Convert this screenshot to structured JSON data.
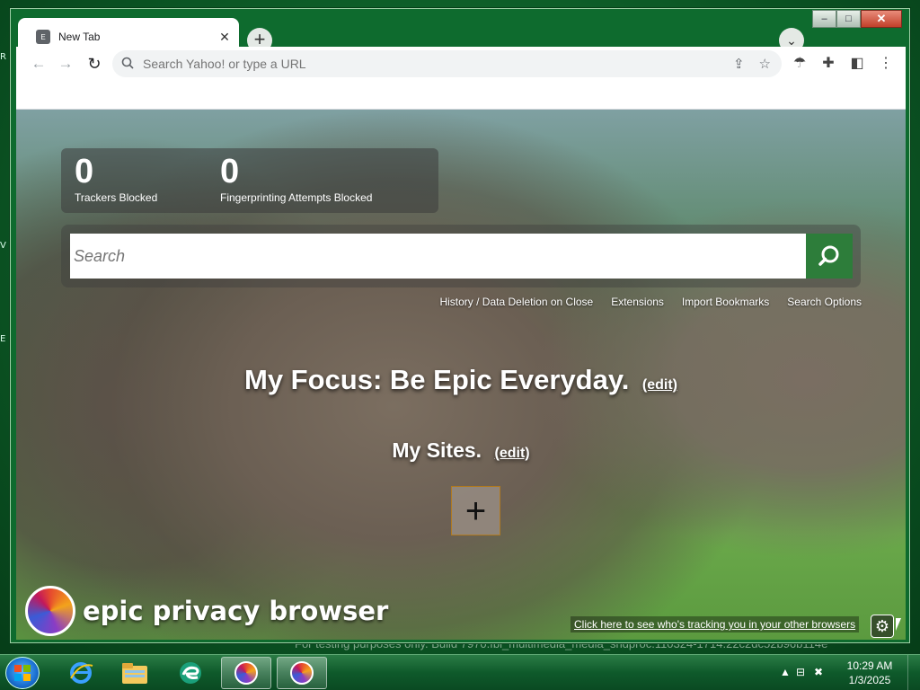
{
  "window": {
    "caption": {
      "minimize": "–",
      "maximize": "□",
      "close": "✕"
    }
  },
  "tabs": [
    {
      "title": "New Tab",
      "favicon": "E"
    }
  ],
  "toolbar": {
    "omnibox_placeholder": "Search Yahoo! or type a URL"
  },
  "newtab_page": {
    "stats": [
      {
        "value": "0",
        "label": "Trackers Blocked"
      },
      {
        "value": "0",
        "label": "Fingerprinting Attempts Blocked"
      }
    ],
    "search_placeholder": "Search",
    "links": [
      "History / Data Deletion on Close",
      "Extensions",
      "Import Bookmarks",
      "Search Options"
    ],
    "focus_text": "My Focus: Be Epic Everyday.",
    "focus_edit": "(edit)",
    "sites_title": "My Sites.",
    "sites_edit": "(edit)",
    "add_site": "+",
    "brand": "epic privacy browser",
    "tracking_link": "Click here to see who's tracking you in your other browsers"
  },
  "desktop": {
    "watermark": "For testing purposes only. Build 7970.fbl_multimedia_media_sndproc.110324-1714.22c2dc52b96b114e"
  },
  "taskbar": {
    "clock_time": "10:29 AM",
    "clock_date": "1/3/2025",
    "apps": [
      "internet-explorer",
      "file-explorer",
      "edge",
      "epic-browser",
      "epic-browser"
    ]
  },
  "colors": {
    "accent_green": "#2d7d3a",
    "window_frame": "#0e6b2e"
  }
}
